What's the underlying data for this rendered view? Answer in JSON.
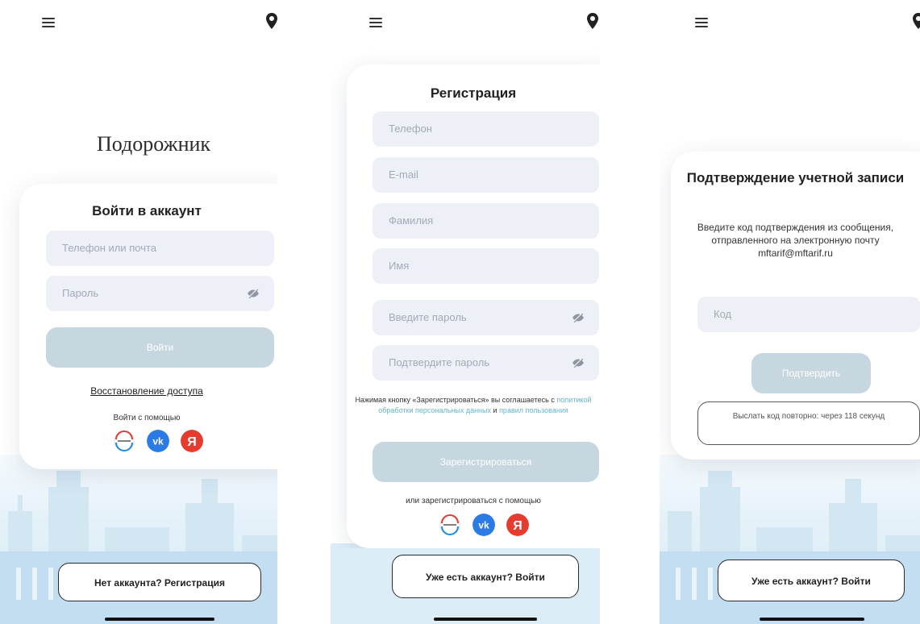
{
  "screens": [
    {
      "brand": "Подорожник",
      "title": "Войти в аккаунт",
      "fields": [
        {
          "placeholder": "Телефон или почта"
        },
        {
          "placeholder": "Пароль"
        }
      ],
      "primary_button": "Войти",
      "recover_link": "Восстановление доступа",
      "login_with": "Войти с помощью",
      "social_icons": [
        "sber-id-icon",
        "vk-icon",
        "yandex-icon"
      ],
      "bottom_button": "Нет аккаунта? Регистрация"
    },
    {
      "title": "Регистрация",
      "fields": [
        {
          "placeholder": "Телефон"
        },
        {
          "placeholder": "E-mail"
        },
        {
          "placeholder": "Фамилия"
        },
        {
          "placeholder": "Имя"
        },
        {
          "placeholder": "Введите пароль"
        },
        {
          "placeholder": "Подтвердите пароль"
        }
      ],
      "terms_prefix": "Нажимая кнопку «Зарегистрироваться» вы соглашаетесь с",
      "terms_policy": "политикой обработки персональных данных",
      "terms_and": "и",
      "terms_rules": "правил пользования",
      "primary_button": "Зарегистрироваться",
      "register_with": "или зарегистрироваться с помощью",
      "social_icons": [
        "sber-id-icon",
        "vk-icon",
        "yandex-icon"
      ],
      "bottom_button": "Уже есть аккаунт? Войти"
    },
    {
      "title": "Подтверждение учетной записи",
      "description": "Введите код подтверждения из сообщения, отправленного на электронную почту mftarif@mftarif.ru",
      "fields": [
        {
          "placeholder": "Код"
        }
      ],
      "primary_button": "Подтвердить",
      "resend_button": "Выслать код повторно: через 118 секунд",
      "bottom_button": "Уже есть аккаунт? Войти"
    }
  ],
  "colors": {
    "field_bg": "#eef0f8",
    "primary_disabled": "#c6d7e0",
    "link_accent": "#66b5c8",
    "vk": "#2a7be4",
    "yandex": "#e63b2e"
  },
  "icons": {
    "menu": "menu-icon",
    "location": "location-pin-icon",
    "password_toggle": "eye-off-icon"
  }
}
